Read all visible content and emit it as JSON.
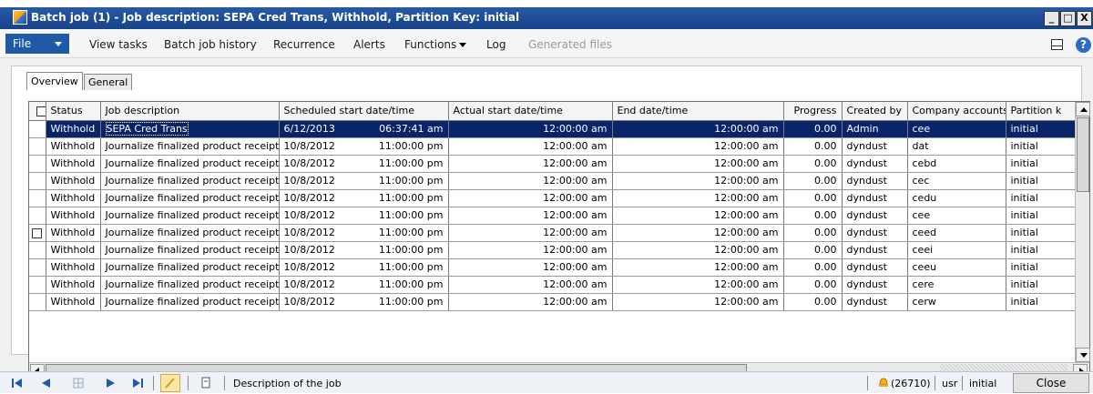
{
  "window": {
    "title": "Batch job (1) - Job description: SEPA Cred Trans, Withhold, Partition Key: initial",
    "buttons": [
      "_",
      "□",
      "X"
    ]
  },
  "menu": {
    "file": "File",
    "items": [
      "View tasks",
      "Batch job history",
      "Recurrence",
      "Alerts",
      "Functions",
      "Log",
      "Generated files"
    ],
    "help": "?"
  },
  "tabs": [
    "Overview",
    "General"
  ],
  "grid": {
    "columns": [
      "Status",
      "Job description",
      "Scheduled start date/time",
      "Actual start date/time",
      "End date/time",
      "Progress",
      "Created by",
      "Company accounts",
      "Partition k"
    ],
    "rows": [
      {
        "status": "Withhold",
        "description": "SEPA Cred Trans",
        "sched_date": "6/12/2013",
        "sched_time": "06:37:41 am",
        "actual": "12:00:00 am",
        "end": "12:00:00 am",
        "progress": "0.00",
        "created_by": "Admin",
        "company": "cee",
        "partition": "initial"
      },
      {
        "status": "Withhold",
        "description": "Journalize finalized product receipts",
        "sched_date": "10/8/2012",
        "sched_time": "11:00:00 pm",
        "actual": "12:00:00 am",
        "end": "12:00:00 am",
        "progress": "0.00",
        "created_by": "dyndust",
        "company": "dat",
        "partition": "initial"
      },
      {
        "status": "Withhold",
        "description": "Journalize finalized product receipts",
        "sched_date": "10/8/2012",
        "sched_time": "11:00:00 pm",
        "actual": "12:00:00 am",
        "end": "12:00:00 am",
        "progress": "0.00",
        "created_by": "dyndust",
        "company": "cebd",
        "partition": "initial"
      },
      {
        "status": "Withhold",
        "description": "Journalize finalized product receipts",
        "sched_date": "10/8/2012",
        "sched_time": "11:00:00 pm",
        "actual": "12:00:00 am",
        "end": "12:00:00 am",
        "progress": "0.00",
        "created_by": "dyndust",
        "company": "cec",
        "partition": "initial"
      },
      {
        "status": "Withhold",
        "description": "Journalize finalized product receipts",
        "sched_date": "10/8/2012",
        "sched_time": "11:00:00 pm",
        "actual": "12:00:00 am",
        "end": "12:00:00 am",
        "progress": "0.00",
        "created_by": "dyndust",
        "company": "cedu",
        "partition": "initial"
      },
      {
        "status": "Withhold",
        "description": "Journalize finalized product receipts",
        "sched_date": "10/8/2012",
        "sched_time": "11:00:00 pm",
        "actual": "12:00:00 am",
        "end": "12:00:00 am",
        "progress": "0.00",
        "created_by": "dyndust",
        "company": "cee",
        "partition": "initial"
      },
      {
        "status": "Withhold",
        "description": "Journalize finalized product receipts",
        "sched_date": "10/8/2012",
        "sched_time": "11:00:00 pm",
        "actual": "12:00:00 am",
        "end": "12:00:00 am",
        "progress": "0.00",
        "created_by": "dyndust",
        "company": "ceed",
        "partition": "initial"
      },
      {
        "status": "Withhold",
        "description": "Journalize finalized product receipts",
        "sched_date": "10/8/2012",
        "sched_time": "11:00:00 pm",
        "actual": "12:00:00 am",
        "end": "12:00:00 am",
        "progress": "0.00",
        "created_by": "dyndust",
        "company": "ceei",
        "partition": "initial"
      },
      {
        "status": "Withhold",
        "description": "Journalize finalized product receipts",
        "sched_date": "10/8/2012",
        "sched_time": "11:00:00 pm",
        "actual": "12:00:00 am",
        "end": "12:00:00 am",
        "progress": "0.00",
        "created_by": "dyndust",
        "company": "ceeu",
        "partition": "initial"
      },
      {
        "status": "Withhold",
        "description": "Journalize finalized product receipts",
        "sched_date": "10/8/2012",
        "sched_time": "11:00:00 pm",
        "actual": "12:00:00 am",
        "end": "12:00:00 am",
        "progress": "0.00",
        "created_by": "dyndust",
        "company": "cere",
        "partition": "initial"
      },
      {
        "status": "Withhold",
        "description": "Journalize finalized product receipts",
        "sched_date": "10/8/2012",
        "sched_time": "11:00:00 pm",
        "actual": "12:00:00 am",
        "end": "12:00:00 am",
        "progress": "0.00",
        "created_by": "dyndust",
        "company": "cerw",
        "partition": "initial"
      }
    ]
  },
  "statusbar": {
    "description": "Description of the job",
    "alerts": "(26710)",
    "user": "usr",
    "partition": "initial",
    "close": "Close"
  },
  "colors": {
    "title_bar": "#1f4f96",
    "selection": "#0a246a",
    "file_button": "#1f5aa6"
  },
  "icons": [
    "app-icon",
    "panel-icon",
    "help-icon",
    "nav-first-icon",
    "nav-prev-icon",
    "nav-grid-icon",
    "nav-next-icon",
    "nav-last-icon",
    "edit-icon",
    "attachment-icon",
    "bell-icon"
  ]
}
